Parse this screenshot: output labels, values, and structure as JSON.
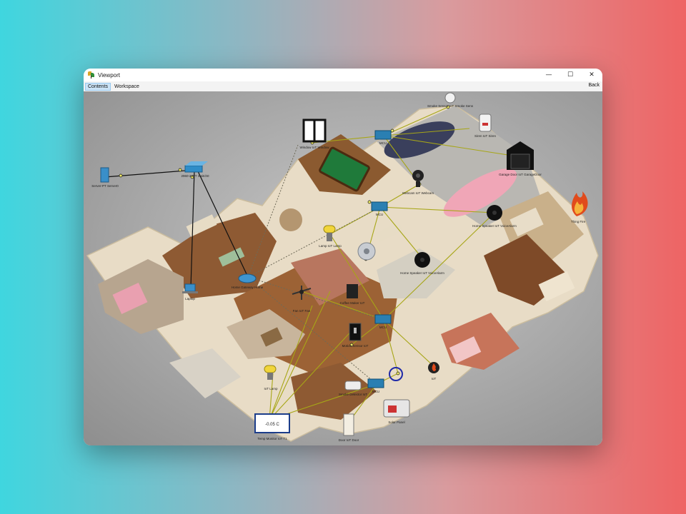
{
  "window": {
    "title": "Viewport",
    "controls": {
      "minimize": "—",
      "maximize": "☐",
      "close": "✕"
    }
  },
  "menubar": {
    "tabs": [
      {
        "label": "Contents",
        "active": true
      },
      {
        "label": "Workspace",
        "active": false
      }
    ],
    "back_label": "Back"
  },
  "devices": {
    "server": {
      "label": "Server-PT Server0",
      "icon": "server-icon"
    },
    "switch": {
      "label": "2960-24TT Switch0",
      "icon": "switch-icon"
    },
    "window": {
      "label": "Window IoT Window",
      "icon": "window-icon"
    },
    "smoke_sensor": {
      "label": "Smoke Sensor IoT Smoke Sens",
      "icon": "smoke-sensor-icon"
    },
    "siren": {
      "label": "Siren IoT Siren",
      "icon": "siren-icon"
    },
    "garage_door": {
      "label": "Garage Door IoT GarageDoor",
      "icon": "garage-door-icon"
    },
    "fire": {
      "label": "Thing Fire",
      "icon": "fire-icon"
    },
    "webcam": {
      "label": "Webcam IoT Webcam",
      "icon": "webcam-icon"
    },
    "speaker1": {
      "label": "Home Speaker IoT VoiceAlarm",
      "icon": "speaker-icon"
    },
    "speaker2": {
      "label": "Home Speaker IoT VoiceAlarm",
      "icon": "speaker-icon"
    },
    "lamp1": {
      "label": "Lamp IoT Lamp",
      "icon": "lamp-icon"
    },
    "lamp2": {
      "label": "IoT Lamp",
      "icon": "lamp-icon"
    },
    "fan": {
      "label": "Fan IoT Fan",
      "icon": "fan-icon"
    },
    "fan_ceiling": {
      "label": "",
      "icon": "ceiling-fan-icon"
    },
    "coffee": {
      "label": "Coffee Maker IoT",
      "icon": "coffee-maker-icon"
    },
    "motion": {
      "label": "Motion Sensor IoT",
      "icon": "motion-sensor-icon"
    },
    "thermostat": {
      "label": "Smart Thermostat",
      "icon": "thermostat-icon"
    },
    "temp_monitor": {
      "label": "Temp Monitor IoT T1",
      "display": "-0.05 C",
      "icon": "temperature-monitor-icon"
    },
    "door": {
      "label": "Door IoT Door",
      "icon": "door-icon"
    },
    "smoke_detector": {
      "label": "Smoke Detector IoT",
      "icon": "smoke-detector-icon"
    },
    "trip_sensor": {
      "label": "Trip Sensor",
      "icon": "trip-sensor-icon"
    },
    "fire_sensor": {
      "label": "IoT",
      "icon": "fire-sensor-icon"
    },
    "solar": {
      "label": "Solar Panel",
      "icon": "solar-panel-icon"
    },
    "home_gateway": {
      "label": "Home Gateway Home",
      "icon": "wireless-router-icon"
    },
    "laptop": {
      "label": "Laptop",
      "icon": "laptop-icon"
    },
    "mcu1": {
      "label": "MCU",
      "icon": "mcu-board-icon"
    },
    "mcu2": {
      "label": "MCU",
      "icon": "mcu-board-icon"
    },
    "mcu3": {
      "label": "MCU",
      "icon": "mcu-board-icon"
    },
    "mcu4": {
      "label": "MCU",
      "icon": "mcu-board-icon"
    },
    "ring": {
      "label": "",
      "icon": "ring-icon"
    }
  },
  "colors": {
    "link_yellow": "#a7a617",
    "link_black": "#111111",
    "wall": "#e9dfcc",
    "floor_wood": "#9a5a2a",
    "floor_tile": "#c9b9a0"
  }
}
